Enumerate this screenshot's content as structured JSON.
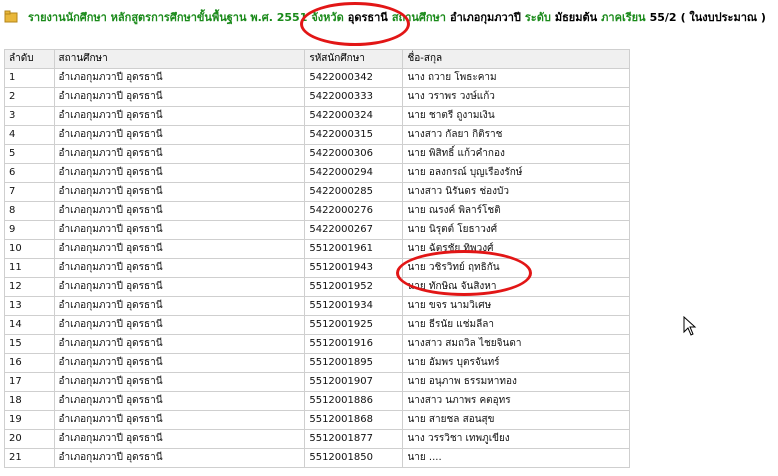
{
  "header": {
    "segments": [
      {
        "text": "รายงานนักศึกษา หลักสูตรการศึกษาขั้นพื้นฐาน พ.ศ. 2551",
        "style": "g"
      },
      {
        "text": "จังหวัด",
        "style": "g"
      },
      {
        "text": "อุดรธานี",
        "style": "k"
      },
      {
        "text": "สถานศึกษา",
        "style": "g"
      },
      {
        "text": "อำเภอกุมภวาปี",
        "style": "k"
      },
      {
        "text": "ระดับ",
        "style": "g"
      },
      {
        "text": "มัธยมต้น",
        "style": "k"
      },
      {
        "text": "ภาคเรียน",
        "style": "g"
      },
      {
        "text": "55/2",
        "style": "k"
      },
      {
        "text": "( ในงบประมาณ )",
        "style": "k"
      }
    ]
  },
  "table": {
    "columns": [
      "ลำดับ",
      "สถานศึกษา",
      "รหัสนักศึกษา",
      "ชื่อ-สกุล"
    ],
    "rows": [
      [
        "1",
        "อำเภอกุมภวาปี อุดรธานี",
        "5422000342",
        "นาง ถวาย โพธะคาม"
      ],
      [
        "2",
        "อำเภอกุมภวาปี อุดรธานี",
        "5422000333",
        "นาง วราพร วงษ์แก้ว"
      ],
      [
        "3",
        "อำเภอกุมภวาปี อุดรธานี",
        "5422000324",
        "นาย ชาตรี ถูงามเงิน"
      ],
      [
        "4",
        "อำเภอกุมภวาปี อุดรธานี",
        "5422000315",
        "นางสาว กัลยา กิติราช"
      ],
      [
        "5",
        "อำเภอกุมภวาปี อุดรธานี",
        "5422000306",
        "นาย พิสิทธิ์ แก้วคำกอง"
      ],
      [
        "6",
        "อำเภอกุมภวาปี อุดรธานี",
        "5422000294",
        "นาย อลงกรณ์ บุญเรืองรักษ์"
      ],
      [
        "7",
        "อำเภอกุมภวาปี อุดรธานี",
        "5422000285",
        "นางสาว นิรันดร ช่องบัว"
      ],
      [
        "8",
        "อำเภอกุมภวาปี อุดรธานี",
        "5422000276",
        "นาย ณรงค์ พิลาร์โชติ"
      ],
      [
        "9",
        "อำเภอกุมภวาปี อุดรธานี",
        "5422000267",
        "นาย นิรุตต์ โยธาวงศ์"
      ],
      [
        "10",
        "อำเภอกุมภวาปี อุดรธานี",
        "5512001961",
        "นาย ฉัตรชัย ทิพวงศ์"
      ],
      [
        "11",
        "อำเภอกุมภวาปี อุดรธานี",
        "5512001943",
        "นาย วชิรวิทย์ ฤทธิกัน"
      ],
      [
        "12",
        "อำเภอกุมภวาปี อุดรธานี",
        "5512001952",
        "นาย ทักษิณ จันสิงหา"
      ],
      [
        "13",
        "อำเภอกุมภวาปี อุดรธานี",
        "5512001934",
        "นาย ขจร นามวิเศษ"
      ],
      [
        "14",
        "อำเภอกุมภวาปี อุดรธานี",
        "5512001925",
        "นาย ธีรนัย แช่มลีลา"
      ],
      [
        "15",
        "อำเภอกุมภวาปี อุดรธานี",
        "5512001916",
        "นางสาว สมถวิล ไชยจินดา"
      ],
      [
        "16",
        "อำเภอกุมภวาปี อุดรธานี",
        "5512001895",
        "นาย อัมพร บุตรจันทร์"
      ],
      [
        "17",
        "อำเภอกุมภวาปี อุดรธานี",
        "5512001907",
        "นาย อนุภาพ ธรรมหาทอง"
      ],
      [
        "18",
        "อำเภอกุมภวาปี อุดรธานี",
        "5512001886",
        "นางสาว นภาพร คตอุทร"
      ],
      [
        "19",
        "อำเภอกุมภวาปี อุดรธานี",
        "5512001868",
        "นาย สายชล สอนสุข"
      ],
      [
        "20",
        "อำเภอกุมภวาปี อุดรธานี",
        "5512001877",
        "นาง วรรวิชา เทพภูเขียง"
      ],
      [
        "21",
        "อำเภอกุมภวาปี อุดรธานี",
        "5512001850",
        "นาย ...."
      ]
    ]
  },
  "colors": {
    "label_green": "#1a8a1a",
    "highlight_red": "#e21616",
    "border": "#cfcfcf"
  },
  "icons": {
    "folder": "folder-icon",
    "cursor": "mouse-cursor-icon"
  }
}
